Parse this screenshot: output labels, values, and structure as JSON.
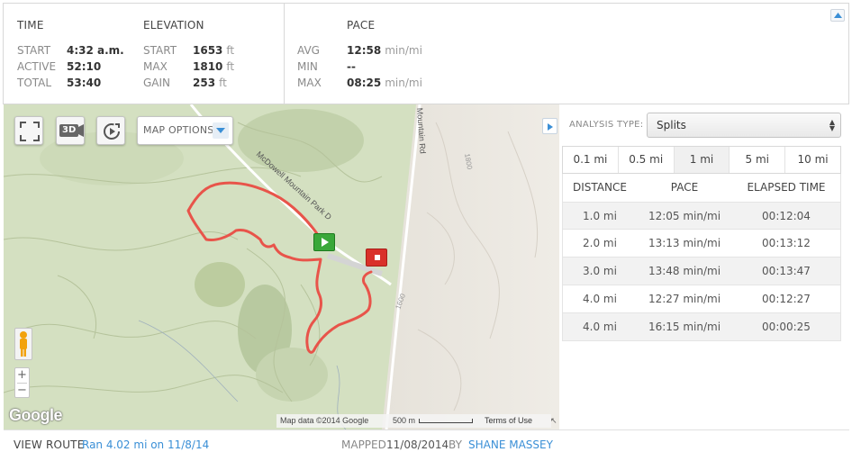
{
  "stats": {
    "time": {
      "title": "TIME",
      "rows": [
        {
          "label": "START",
          "value": "4:32 a.m."
        },
        {
          "label": "ACTIVE",
          "value": "52:10"
        },
        {
          "label": "TOTAL",
          "value": "53:40"
        }
      ]
    },
    "elevation": {
      "title": "ELEVATION",
      "rows": [
        {
          "label": "START",
          "value": "1653",
          "unit": "ft"
        },
        {
          "label": "MAX",
          "value": "1810",
          "unit": "ft"
        },
        {
          "label": "GAIN",
          "value": "253",
          "unit": "ft"
        }
      ]
    },
    "pace": {
      "title": "PACE",
      "rows": [
        {
          "label": "AVG",
          "value": "12:58",
          "unit": "min/mi"
        },
        {
          "label": "MIN",
          "value": "--"
        },
        {
          "label": "MAX",
          "value": "08:25",
          "unit": "min/mi"
        }
      ]
    }
  },
  "map": {
    "options_label": "MAP OPTIONS",
    "btn_3d": "3D",
    "zoom_in": "+",
    "zoom_out": "−",
    "logo": "Google",
    "attribution": "Map data ©2014 Google",
    "scale_label": "500 m",
    "terms": "Terms of Use",
    "road_labels": [
      "McDowell Mountain Park D",
      "Mountain Rd",
      "1800",
      "1600"
    ],
    "colors": {
      "route": "#e8544a",
      "start": "#3aa83a",
      "end": "#d9312a"
    }
  },
  "panel": {
    "analysis_label": "ANALYSIS TYPE:",
    "analysis_value": "Splits",
    "tabs": [
      "0.1 mi",
      "0.5 mi",
      "1 mi",
      "5 mi",
      "10 mi"
    ],
    "active_tab": "1 mi",
    "headers": [
      "DISTANCE",
      "PACE",
      "ELAPSED TIME"
    ],
    "rows": [
      [
        "1.0 mi",
        "12:05 min/mi",
        "00:12:04"
      ],
      [
        "2.0 mi",
        "13:13 min/mi",
        "00:13:12"
      ],
      [
        "3.0 mi",
        "13:48 min/mi",
        "00:13:47"
      ],
      [
        "4.0 mi",
        "12:27 min/mi",
        "00:12:27"
      ],
      [
        "4.0 mi",
        "16:15 min/mi",
        "00:00:25"
      ]
    ]
  },
  "footer": {
    "view_route": "VIEW ROUTE",
    "route_link": "Ran 4.02 mi on 11/8/14",
    "mapped_label": "MAPPED",
    "mapped_date": "11/08/2014",
    "by_label": "BY",
    "author": "SHANE MASSEY"
  }
}
